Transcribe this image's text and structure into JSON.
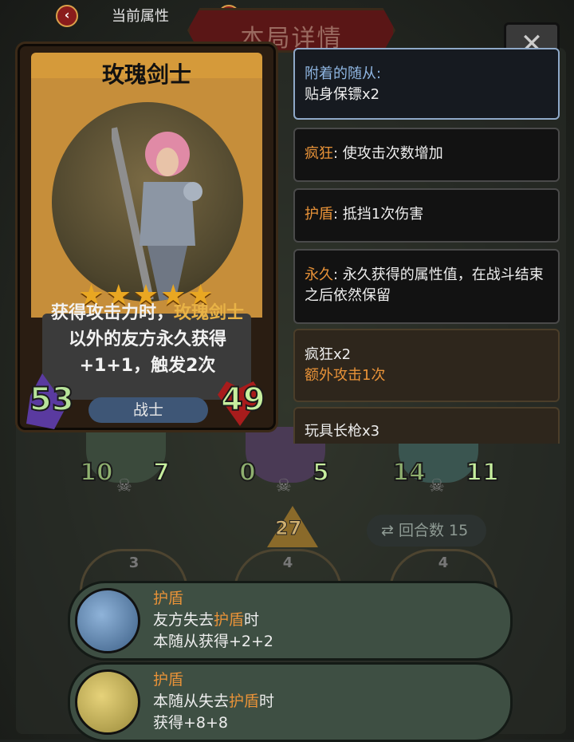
{
  "header": {
    "prev_label": "‹",
    "tab_title": "当前属性",
    "next_label": "›",
    "banner_title": "本局详情",
    "close_label": "✕"
  },
  "card": {
    "name": "玫瑰剑士",
    "stars": "★★★★★",
    "star_count": 5,
    "desc_part1": "获得攻击力时，",
    "desc_highlight": "玫瑰剑士",
    "desc_part2": "以外的友方永久获得+1+1，触发2次",
    "attack": "53",
    "health": "49",
    "class_label": "战士"
  },
  "info_panels": [
    {
      "title": "附着的随从:",
      "text": "贴身保镖x2"
    },
    {
      "title": "疯狂",
      "text": ": 使攻击次数增加"
    },
    {
      "title": "护盾",
      "text": ": 抵挡1次伤害"
    },
    {
      "title": "永久",
      "text": ": 永久获得的属性值，在战斗结束之后依然保留"
    },
    {
      "title": "疯狂x2",
      "text": "额外攻击1次"
    },
    {
      "title": "玩具长枪x3",
      "text": ""
    }
  ],
  "board": {
    "units": [
      {
        "attack": "10",
        "health": "7"
      },
      {
        "attack": "0",
        "health": "5"
      },
      {
        "attack": "14",
        "health": "11"
      }
    ],
    "arrow_value": "27",
    "round_label": "回合数",
    "round_value": "15",
    "slots": [
      "3",
      "4",
      "4"
    ]
  },
  "tooltips": [
    {
      "title": "护盾",
      "line1_a": "友方失去",
      "line1_b": "护盾",
      "line1_c": "时",
      "line2": "本随从获得+2+2"
    },
    {
      "title": "护盾",
      "line1_a": "本随从失去",
      "line1_b": "护盾",
      "line1_c": "时",
      "line2": "获得+8+8"
    }
  ],
  "colors": {
    "accent_orange": "#e89238",
    "accent_blue": "#8fb6e2",
    "star_gold": "#e9a722",
    "tooltip_bg": "#3e4f43"
  }
}
